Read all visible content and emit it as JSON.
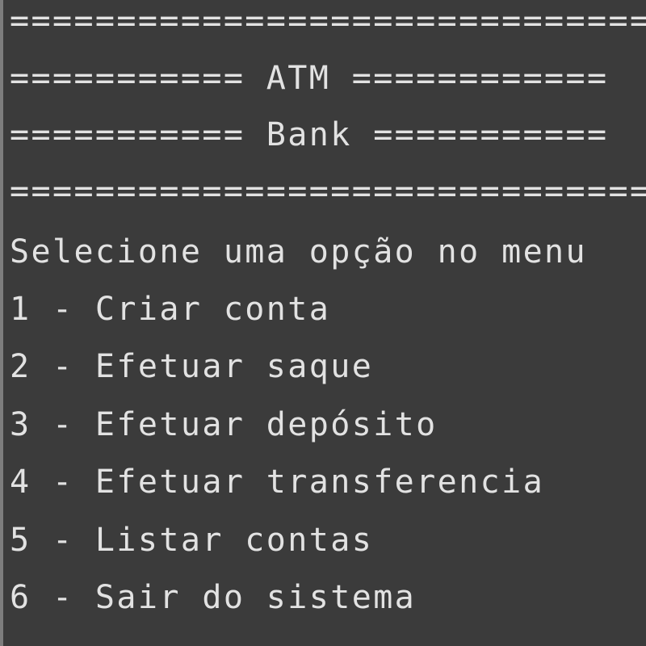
{
  "header": {
    "border_top": "==============================",
    "atm_line": "=========== ATM ============",
    "bank_line": "=========== Bank ===========",
    "border_bottom": "=============================="
  },
  "menu": {
    "prompt": "Selecione uma opção no menu",
    "options": [
      "1 - Criar conta",
      "2 - Efetuar saque",
      "3 - Efetuar depósito",
      "4 - Efetuar transferencia",
      "5 - Listar contas",
      "6 - Sair do sistema"
    ]
  },
  "colors": {
    "background": "#3b3b3b",
    "text": "#e2e2e2"
  }
}
